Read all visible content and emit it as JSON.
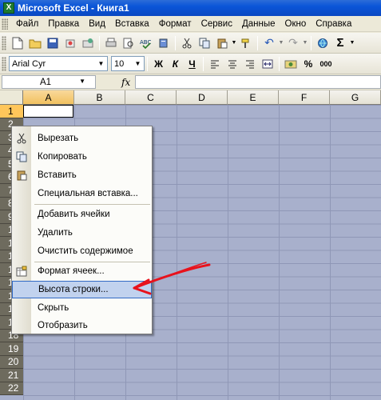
{
  "window": {
    "title": "Microsoft Excel - Книга1",
    "app_icon": "X"
  },
  "menu": [
    {
      "label": "Файл"
    },
    {
      "label": "Правка"
    },
    {
      "label": "Вид"
    },
    {
      "label": "Вставка"
    },
    {
      "label": "Формат"
    },
    {
      "label": "Сервис"
    },
    {
      "label": "Данные"
    },
    {
      "label": "Окно"
    },
    {
      "label": "Справка"
    }
  ],
  "toolbar": {
    "font_name": "Arial Cyr",
    "font_size": "10",
    "bold_label": "Ж",
    "italic_label": "К",
    "underline_label": "Ч",
    "percent_label": "%",
    "thousands_label": "000",
    "sigma_label": "Σ"
  },
  "formula_bar": {
    "name_box": "A1",
    "fx_label": "fx",
    "formula_value": ""
  },
  "columns": [
    "A",
    "B",
    "C",
    "D",
    "E",
    "F",
    "G"
  ],
  "rows": [
    "1",
    "2",
    "3",
    "4",
    "5",
    "6",
    "7",
    "8",
    "9",
    "1",
    "1",
    "1",
    "1",
    "1",
    "1",
    "1",
    "1",
    "18",
    "19",
    "20",
    "21",
    "22"
  ],
  "context_menu": {
    "items": [
      {
        "label": "Вырезать",
        "icon": "scissors-icon"
      },
      {
        "label": "Копировать",
        "icon": "copy-icon"
      },
      {
        "label": "Вставить",
        "icon": "paste-icon"
      },
      {
        "label": "Специальная вставка..."
      },
      {
        "label": "Добавить ячейки"
      },
      {
        "label": "Удалить"
      },
      {
        "label": "Очистить содержимое"
      },
      {
        "label": "Формат ячеек...",
        "icon": "format-cells-icon"
      },
      {
        "label": "Высота строки..."
      },
      {
        "label": "Скрыть"
      },
      {
        "label": "Отобразить"
      }
    ]
  },
  "colors": {
    "grid_bg": "#a8b0cc",
    "highlight": "#c1d2ee",
    "annotation_arrow": "#e8121c"
  }
}
